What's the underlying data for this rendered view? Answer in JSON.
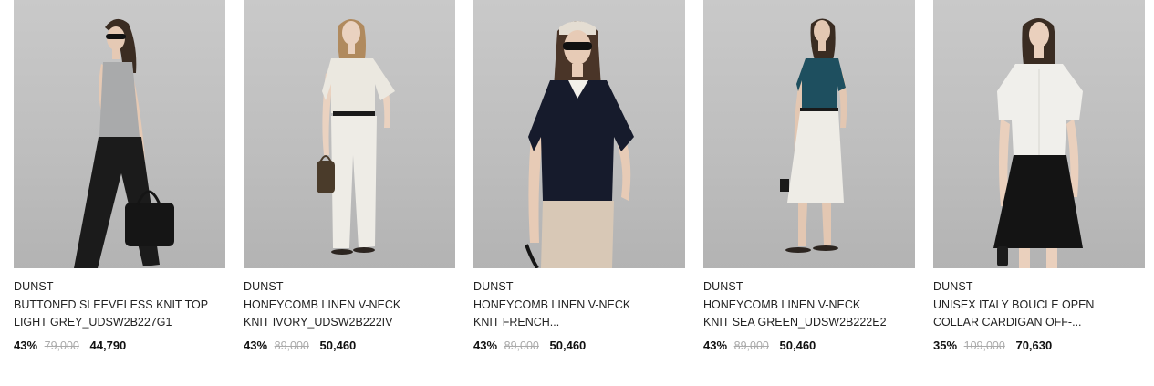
{
  "products": [
    {
      "brand": "DUNST",
      "name_line1": "BUTTONED SLEEVELESS KNIT TOP",
      "name_line2": "LIGHT GREY_UDSW2B227G1",
      "discount": "43%",
      "original_price": "79,000",
      "sale_price": "44,790",
      "image": "model-grey-knit-top-black-pants",
      "top_color": "#a9aaab",
      "bottom_color": "#1b1b1b"
    },
    {
      "brand": "DUNST",
      "name_line1": "HONEYCOMB LINEN V-NECK",
      "name_line2": "KNIT IVORY_UDSW2B222IV",
      "discount": "43%",
      "original_price": "89,000",
      "sale_price": "50,460",
      "image": "model-ivory-knit-white-pants",
      "top_color": "#ebe8e0",
      "bottom_color": "#eeece6"
    },
    {
      "brand": "DUNST",
      "name_line1": "HONEYCOMB LINEN V-NECK",
      "name_line2": "KNIT FRENCH...",
      "discount": "43%",
      "original_price": "89,000",
      "sale_price": "50,460",
      "image": "model-navy-knit-beige-pants",
      "top_color": "#161b2c",
      "bottom_color": "#d8c8b6"
    },
    {
      "brand": "DUNST",
      "name_line1": "HONEYCOMB LINEN V-NECK",
      "name_line2": "KNIT SEA GREEN_UDSW2B222E2",
      "discount": "43%",
      "original_price": "89,000",
      "sale_price": "50,460",
      "image": "model-sea-green-knit-white-skirt",
      "top_color": "#1e4f5f",
      "bottom_color": "#eeece6"
    },
    {
      "brand": "DUNST",
      "name_line1": "UNISEX ITALY BOUCLE OPEN",
      "name_line2": "COLLAR CARDIGAN OFF-...",
      "discount": "35%",
      "original_price": "109,000",
      "sale_price": "70,630",
      "image": "model-white-cardigan-black-skirt",
      "top_color": "#f0efeb",
      "bottom_color": "#141414"
    }
  ]
}
